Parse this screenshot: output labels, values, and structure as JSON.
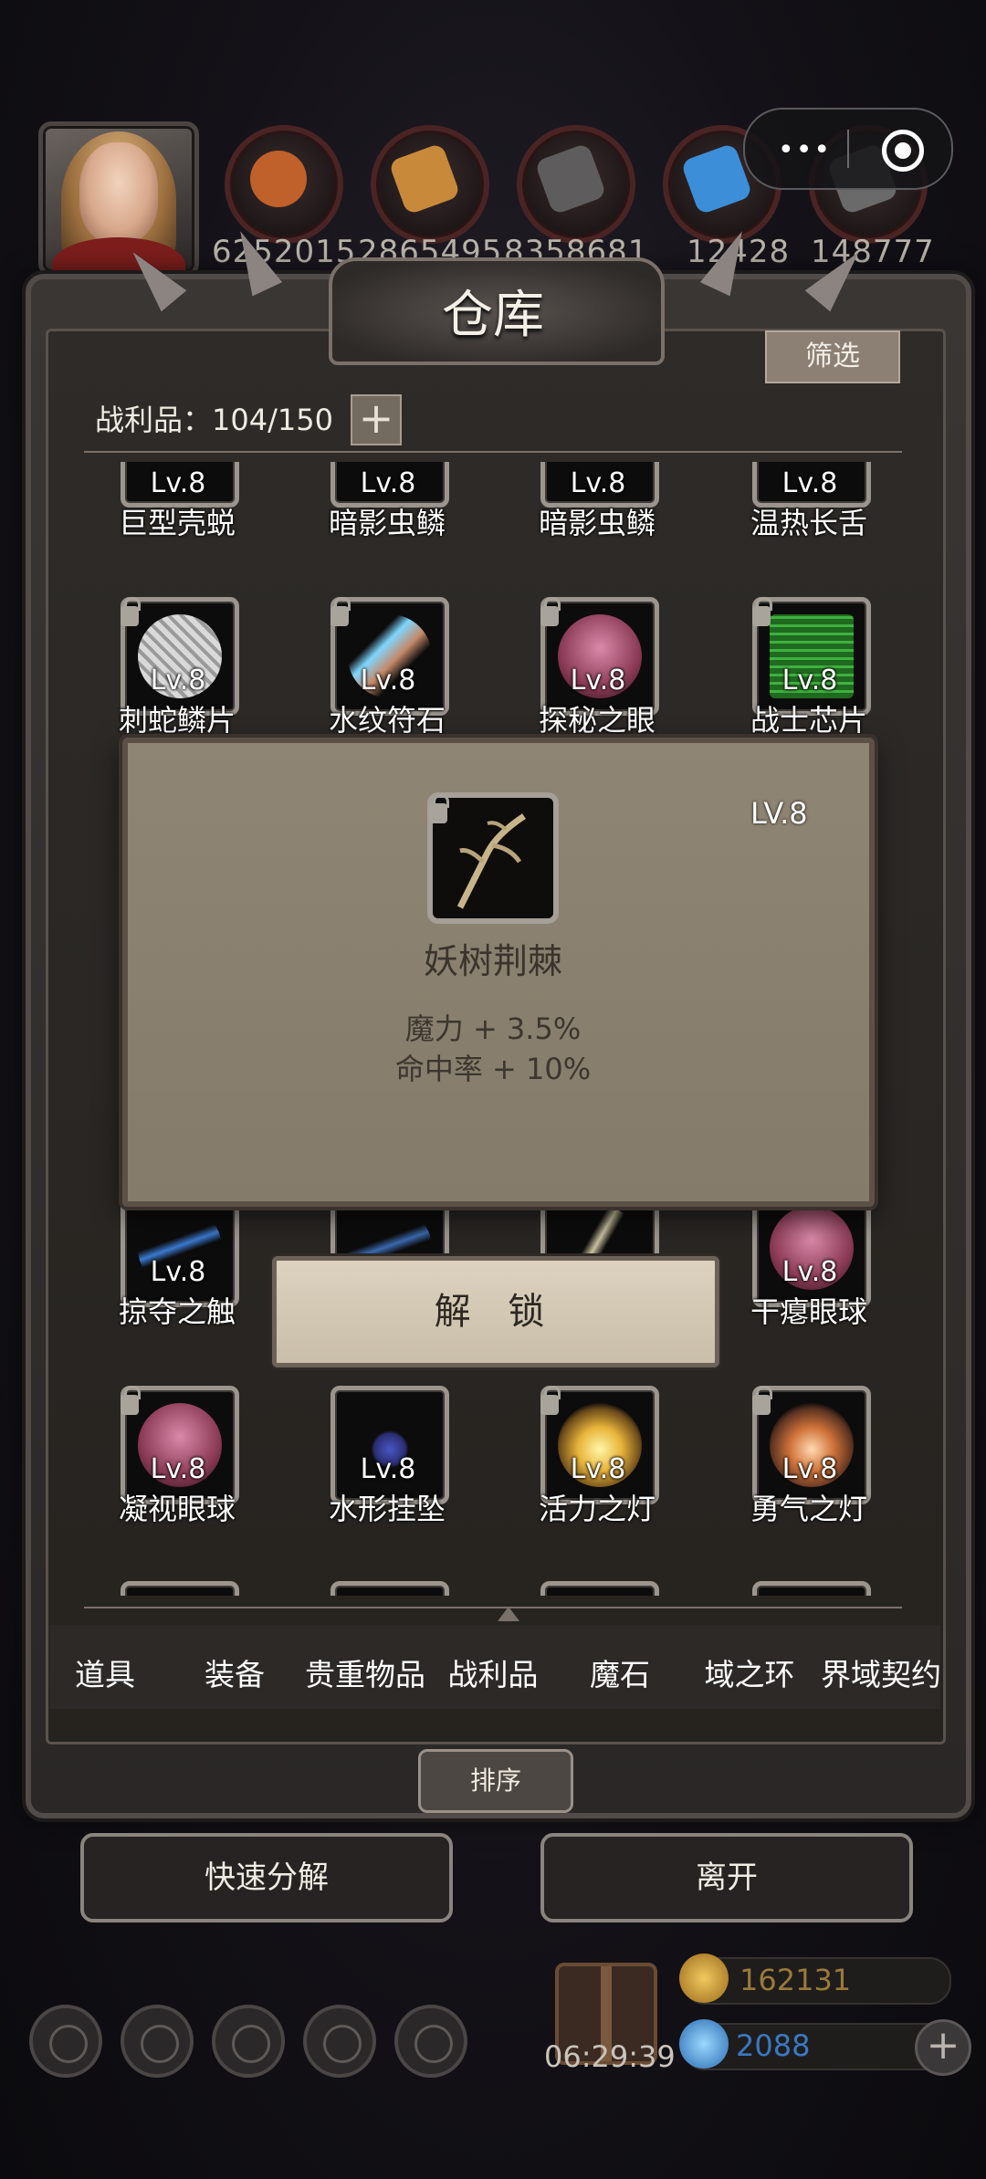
{
  "resources": [
    {
      "value": "6252015",
      "icon": "ore-icon",
      "color": "#c0602a"
    },
    {
      "value": "2865495",
      "icon": "wood-icon",
      "color": "#c88a3a"
    },
    {
      "value": "8358681",
      "icon": "iron-icon",
      "color": "#6a6868"
    },
    {
      "value": "12428",
      "icon": "crystal-icon",
      "color": "#3c8ed8"
    },
    {
      "value": "148777",
      "icon": "steel-icon",
      "color": "#707070"
    }
  ],
  "panel": {
    "title": "仓库",
    "filter_label": "筛选",
    "loot_count_label": "战利品：104/150",
    "expand_label": "+"
  },
  "grid": {
    "row1": [
      {
        "level": "Lv.8",
        "name": "巨型壳蜕"
      },
      {
        "level": "Lv.8",
        "name": "暗影虫鳞"
      },
      {
        "level": "Lv.8",
        "name": "暗影虫鳞"
      },
      {
        "level": "Lv.8",
        "name": "温热长舌"
      }
    ],
    "row2": [
      {
        "level": "Lv.8",
        "name": "刺蛇鳞片",
        "art": "scale-icon"
      },
      {
        "level": "Lv.8",
        "name": "水纹符石",
        "art": "rune-stone-icon"
      },
      {
        "level": "Lv.8",
        "name": "探秘之眼",
        "art": "eyeball-icon"
      },
      {
        "level": "Lv.8",
        "name": "战士芯片",
        "art": "chip-icon"
      }
    ],
    "row5": [
      {
        "level": "Lv.8",
        "name": "掠夺之触"
      },
      {
        "level": "Lv.8",
        "name": "干瘪眼球"
      }
    ],
    "row6": [
      {
        "level": "Lv.8",
        "name": "凝视眼球",
        "art": "eyeball-icon"
      },
      {
        "level": "Lv.8",
        "name": "水形挂坠",
        "art": "pendant-icon"
      },
      {
        "level": "Lv.8",
        "name": "活力之灯",
        "art": "lantern-icon"
      },
      {
        "level": "Lv.8",
        "name": "勇气之灯",
        "art": "lantern-icon"
      }
    ]
  },
  "popup": {
    "level": "LV.8",
    "item_name": "妖树荆棘",
    "stat1": "魔力 + 3.5%",
    "stat2": "命中率 + 10%",
    "unlock_label": "解 锁"
  },
  "tabs": [
    "道具",
    "装备",
    "贵重物品",
    "战利品",
    "魔石",
    "域之环",
    "界域契约"
  ],
  "active_tab": "战利品",
  "sort_label": "排序",
  "quick_decompose_label": "快速分解",
  "leave_label": "离开",
  "bottom": {
    "timer": "06:29:39",
    "gold": "162131",
    "gems": "2088"
  }
}
